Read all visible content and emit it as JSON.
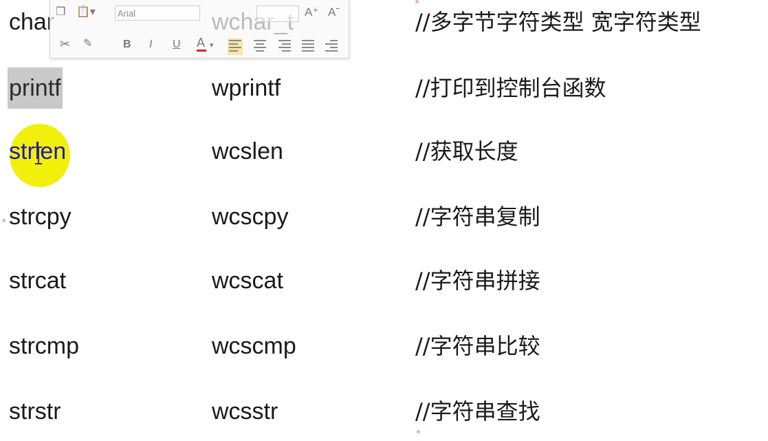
{
  "rows": [
    {
      "col1": "char",
      "col2": "wchar_t",
      "col3": "//多字节字符类型   宽字符类型"
    },
    {
      "col1": "printf",
      "col2": "wprintf",
      "col3": "//打印到控制台函数"
    },
    {
      "col1": "strlen",
      "col2": "wcslen",
      "col3": "//获取长度"
    },
    {
      "col1": "strcpy",
      "col2": "wcscpy",
      "col3": "//字符串复制"
    },
    {
      "col1": "strcat",
      "col2": "wcscat",
      "col3": "//字符串拼接"
    },
    {
      "col1": "strcmp",
      "col2": "wcscmp",
      "col3": "//字符串比较"
    },
    {
      "col1": "strstr",
      "col2": "wcsstr",
      "col3": "//字符串查找"
    }
  ],
  "toolbar": {
    "font_name": "Arial",
    "grow_font": "A⁺",
    "shrink_font": "Aˉ",
    "bold": "B",
    "italic": "I",
    "underline": "U",
    "font_color": "A",
    "font_color_hex": "#e02020"
  },
  "highlight": {
    "selected_row": 1,
    "cursor_row": 2,
    "cursor_color": "#f2ee00"
  }
}
